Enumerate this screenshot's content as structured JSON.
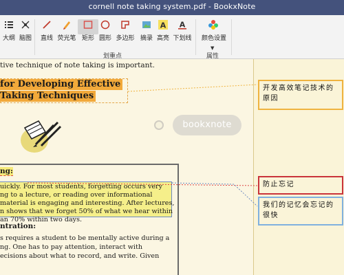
{
  "window": {
    "title": "cornell note taking system.pdf - BookxNote"
  },
  "ribbon": {
    "tools": [
      {
        "label": "大纲",
        "icon": "outline-list-icon"
      },
      {
        "label": "脑图",
        "icon": "mindmap-icon"
      },
      {
        "label": "直线",
        "icon": "line-tool-icon"
      },
      {
        "label": "荧光笔",
        "icon": "highlighter-icon"
      },
      {
        "label": "矩形",
        "icon": "rectangle-tool-icon"
      },
      {
        "label": "圆形",
        "icon": "circle-tool-icon"
      },
      {
        "label": "多边形",
        "icon": "polygon-tool-icon"
      },
      {
        "label": "摘录",
        "icon": "excerpt-icon"
      },
      {
        "label": "高亮",
        "icon": "highlight-a-icon"
      },
      {
        "label": "下划线",
        "icon": "underline-a-icon"
      },
      {
        "label": "颜色设置",
        "icon": "color-palette-icon"
      }
    ],
    "group_markup": "划重点",
    "group_properties": "属性",
    "active_tool": "矩形",
    "colors": {
      "accent_active": "#d4d4d4",
      "rect_icon": "#d9534f"
    }
  },
  "document": {
    "line1": "tive technique of note taking is important.",
    "heading_line1": "for Developing Effective",
    "heading_line2": "Taking Techniques",
    "mindmap_node": "bookxnote",
    "section1_heading": "ng:",
    "section1_lines": [
      "uickly.  For most students, forgetting occurs very",
      "ng to a lecture, or reading over informational",
      "material is engaging and interesting. After lectures,",
      "n shows that we forget 50% of what we hear within",
      "an 70% within two days."
    ],
    "section2_heading": "ntration:",
    "section2_lines": [
      "s requires a student to be mentally active during a",
      "ng.  One has to pay attention, interact with",
      "ecisions about what to record, and write.  Given"
    ],
    "colors": {
      "heading_highlight": "#f2a93a",
      "para_highlight": "#f5ef8a"
    }
  },
  "notes": [
    {
      "text": "开发高效笔记技术的原因",
      "border": "#efb33f"
    },
    {
      "text": "防止忘记",
      "border": "#c9333a"
    },
    {
      "text": "我们的记忆会忘记的很快",
      "border": "#7fb0df"
    }
  ]
}
